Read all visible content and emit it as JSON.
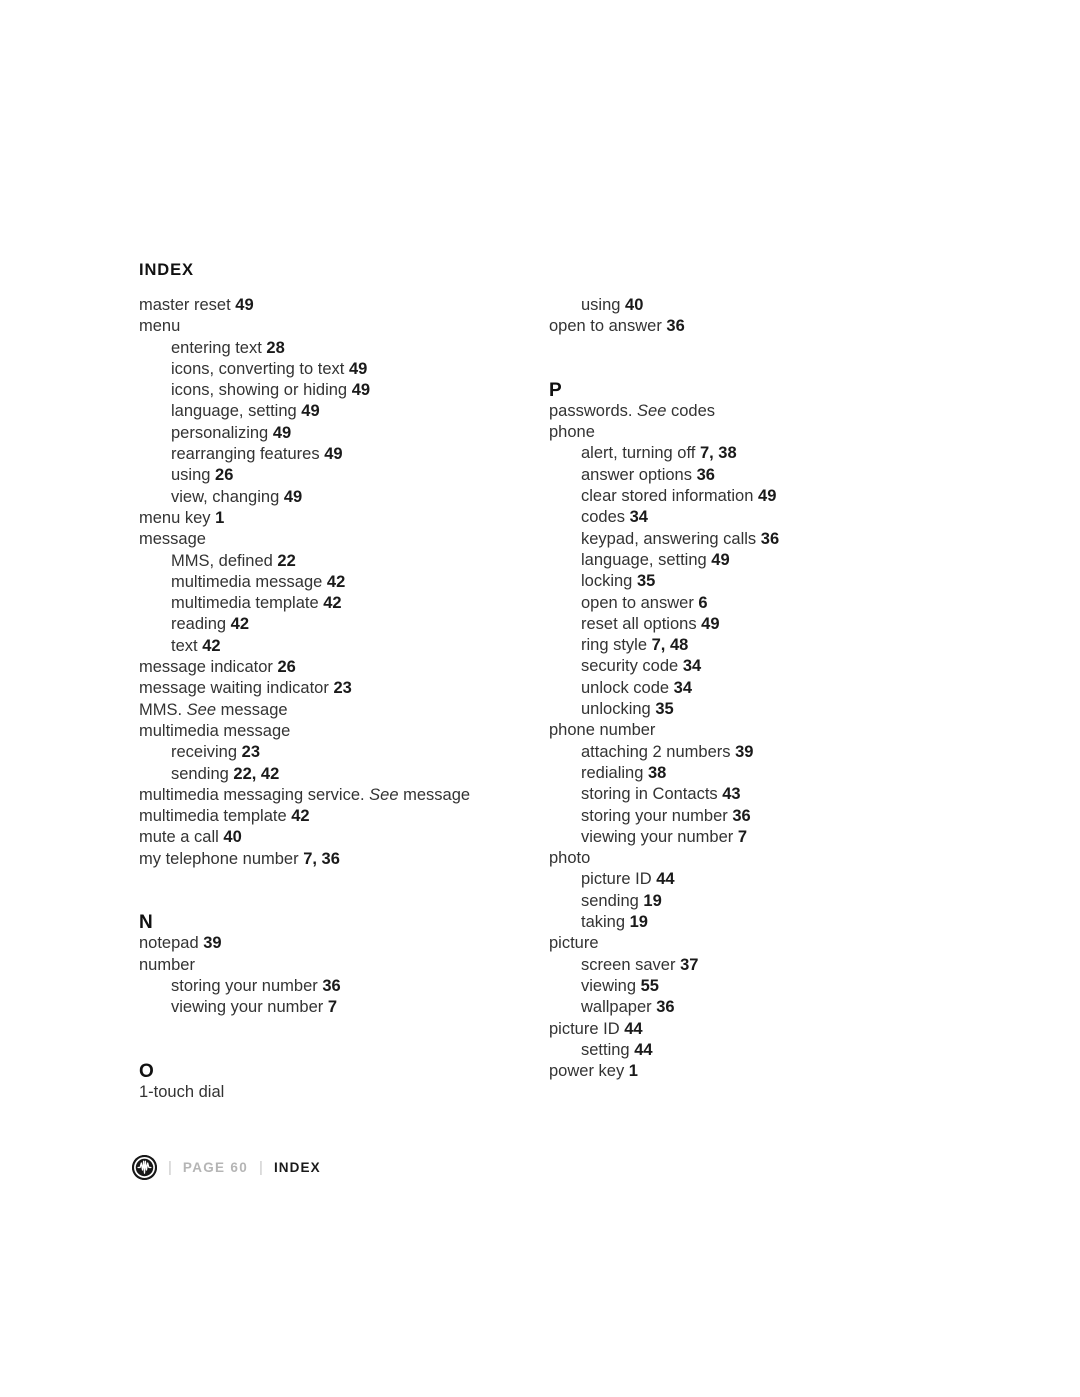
{
  "document": {
    "heading": "INDEX"
  },
  "footer": {
    "brand_icon": "motorola-batwing-icon",
    "separator": "|",
    "page_label": "PAGE 60",
    "section_label": "INDEX"
  },
  "columns": {
    "left": [
      {
        "type": "entry",
        "level": 0,
        "text": "master reset",
        "num": "49"
      },
      {
        "type": "entry",
        "level": 0,
        "text": "menu",
        "num": ""
      },
      {
        "type": "entry",
        "level": 1,
        "text": "entering text",
        "num": "28"
      },
      {
        "type": "entry",
        "level": 1,
        "text": "icons, converting to text",
        "num": "49"
      },
      {
        "type": "entry",
        "level": 1,
        "text": "icons, showing or hiding",
        "num": "49"
      },
      {
        "type": "entry",
        "level": 1,
        "text": "language, setting",
        "num": "49"
      },
      {
        "type": "entry",
        "level": 1,
        "text": "personalizing",
        "num": "49"
      },
      {
        "type": "entry",
        "level": 1,
        "text": "rearranging features",
        "num": "49"
      },
      {
        "type": "entry",
        "level": 1,
        "text": "using",
        "num": "26"
      },
      {
        "type": "entry",
        "level": 1,
        "text": "view, changing",
        "num": "49"
      },
      {
        "type": "entry",
        "level": 0,
        "text": "menu key",
        "num": "1"
      },
      {
        "type": "entry",
        "level": 0,
        "text": "message",
        "num": ""
      },
      {
        "type": "entry",
        "level": 1,
        "text": "MMS, defined",
        "num": "22"
      },
      {
        "type": "entry",
        "level": 1,
        "text": "multimedia message",
        "num": "42"
      },
      {
        "type": "entry",
        "level": 1,
        "text": "multimedia template",
        "num": "42"
      },
      {
        "type": "entry",
        "level": 1,
        "text": "reading",
        "num": "42"
      },
      {
        "type": "entry",
        "level": 1,
        "text": "text",
        "num": "42"
      },
      {
        "type": "entry",
        "level": 0,
        "text": "message indicator",
        "num": "26"
      },
      {
        "type": "entry",
        "level": 0,
        "text": "message waiting indicator",
        "num": "23"
      },
      {
        "type": "xref",
        "level": 0,
        "pre": "MMS. ",
        "see": "See",
        "post": " message"
      },
      {
        "type": "entry",
        "level": 0,
        "text": "multimedia message",
        "num": ""
      },
      {
        "type": "entry",
        "level": 1,
        "text": "receiving",
        "num": "23"
      },
      {
        "type": "entry",
        "level": 1,
        "text": "sending",
        "num": "22, 42"
      },
      {
        "type": "xref",
        "level": 0,
        "pre": "multimedia messaging service. ",
        "see": "See",
        "post": " message"
      },
      {
        "type": "entry",
        "level": 0,
        "text": "multimedia template",
        "num": "42"
      },
      {
        "type": "entry",
        "level": 0,
        "text": "mute a call",
        "num": "40"
      },
      {
        "type": "entry",
        "level": 0,
        "text": "my telephone number",
        "num": "7, 36"
      },
      {
        "type": "letter",
        "text": "N"
      },
      {
        "type": "entry",
        "level": 0,
        "text": "notepad",
        "num": "39"
      },
      {
        "type": "entry",
        "level": 0,
        "text": "number",
        "num": ""
      },
      {
        "type": "entry",
        "level": 1,
        "text": "storing your number",
        "num": "36"
      },
      {
        "type": "entry",
        "level": 1,
        "text": "viewing your number",
        "num": "7"
      },
      {
        "type": "letter",
        "text": "O"
      },
      {
        "type": "entry",
        "level": 0,
        "text": "1-touch dial",
        "num": ""
      }
    ],
    "right": [
      {
        "type": "entry",
        "level": 1,
        "text": "using",
        "num": "40"
      },
      {
        "type": "entry",
        "level": 0,
        "text": "open to answer",
        "num": "36"
      },
      {
        "type": "letter",
        "text": "P"
      },
      {
        "type": "xref",
        "level": 0,
        "pre": "passwords. ",
        "see": "See",
        "post": " codes"
      },
      {
        "type": "entry",
        "level": 0,
        "text": "phone",
        "num": ""
      },
      {
        "type": "entry",
        "level": 1,
        "text": "alert, turning off",
        "num": "7, 38"
      },
      {
        "type": "entry",
        "level": 1,
        "text": "answer options",
        "num": "36"
      },
      {
        "type": "entry",
        "level": 1,
        "text": "clear stored information",
        "num": "49"
      },
      {
        "type": "entry",
        "level": 1,
        "text": "codes",
        "num": "34"
      },
      {
        "type": "entry",
        "level": 1,
        "text": "keypad, answering calls",
        "num": "36"
      },
      {
        "type": "entry",
        "level": 1,
        "text": "language, setting",
        "num": "49"
      },
      {
        "type": "entry",
        "level": 1,
        "text": "locking",
        "num": "35"
      },
      {
        "type": "entry",
        "level": 1,
        "text": "open to answer",
        "num": "6"
      },
      {
        "type": "entry",
        "level": 1,
        "text": "reset all options",
        "num": "49"
      },
      {
        "type": "entry",
        "level": 1,
        "text": "ring style",
        "num": "7, 48"
      },
      {
        "type": "entry",
        "level": 1,
        "text": "security code",
        "num": "34"
      },
      {
        "type": "entry",
        "level": 1,
        "text": "unlock code",
        "num": "34"
      },
      {
        "type": "entry",
        "level": 1,
        "text": "unlocking",
        "num": "35"
      },
      {
        "type": "entry",
        "level": 0,
        "text": "phone number",
        "num": ""
      },
      {
        "type": "entry",
        "level": 1,
        "text": "attaching 2 numbers",
        "num": "39"
      },
      {
        "type": "entry",
        "level": 1,
        "text": "redialing",
        "num": "38"
      },
      {
        "type": "entry",
        "level": 1,
        "text": "storing in Contacts",
        "num": "43"
      },
      {
        "type": "entry",
        "level": 1,
        "text": "storing your number",
        "num": "36"
      },
      {
        "type": "entry",
        "level": 1,
        "text": "viewing your number",
        "num": "7"
      },
      {
        "type": "entry",
        "level": 0,
        "text": "photo",
        "num": ""
      },
      {
        "type": "entry",
        "level": 1,
        "text": "picture ID",
        "num": "44"
      },
      {
        "type": "entry",
        "level": 1,
        "text": "sending",
        "num": "19"
      },
      {
        "type": "entry",
        "level": 1,
        "text": "taking",
        "num": "19"
      },
      {
        "type": "entry",
        "level": 0,
        "text": "picture",
        "num": ""
      },
      {
        "type": "entry",
        "level": 1,
        "text": "screen saver",
        "num": "37"
      },
      {
        "type": "entry",
        "level": 1,
        "text": "viewing",
        "num": "55"
      },
      {
        "type": "entry",
        "level": 1,
        "text": "wallpaper",
        "num": "36"
      },
      {
        "type": "entry",
        "level": 0,
        "text": "picture ID",
        "num": "44"
      },
      {
        "type": "entry",
        "level": 1,
        "text": "setting",
        "num": "44"
      },
      {
        "type": "entry",
        "level": 0,
        "text": "power key",
        "num": "1"
      }
    ]
  }
}
